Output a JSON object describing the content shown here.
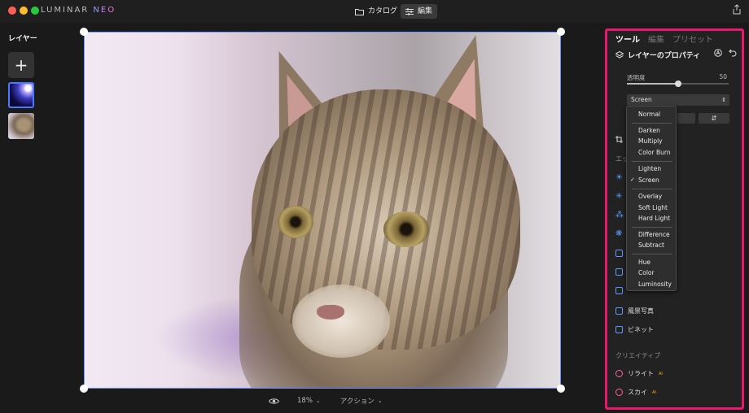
{
  "app": {
    "logo_main": "LUMINAR ",
    "logo_neo": "NEO"
  },
  "colors": {
    "accent_highlight": "#e6196f",
    "selection_border": "#4b78ff"
  },
  "topbar": {
    "catalog_label": "カタログ",
    "edit_label": "編集",
    "active": "edit"
  },
  "layers": {
    "title": "レイヤー",
    "add_symbol": "+"
  },
  "bottom": {
    "zoom": "18%",
    "action_label": "アクション"
  },
  "panel": {
    "tabs": [
      {
        "label": "ツール"
      },
      {
        "label": "編集"
      },
      {
        "label": "プリセット"
      }
    ],
    "properties_title": "レイヤーのプロパティ",
    "opacity_label": "透明度",
    "opacity_value": "50",
    "opacity_fraction": 0.5,
    "blend_mode": "Screen",
    "section_essentials": "エッ",
    "tools": [
      {
        "label": "風景写真",
        "icon": "landscape-icon"
      },
      {
        "label": "ビネット",
        "icon": "vignette-icon"
      }
    ],
    "section_creative": "クリエイティブ",
    "creative_tools": [
      {
        "label": "リライト",
        "ai": "AI",
        "icon": "relight-icon"
      },
      {
        "label": "スカイ",
        "ai": "AI",
        "icon": "sky-icon"
      }
    ]
  },
  "blend_dropdown": {
    "selected": "Screen",
    "groups": [
      [
        "Normal"
      ],
      [
        "Darken",
        "Multiply",
        "Color Burn"
      ],
      [
        "Lighten",
        "Screen"
      ],
      [
        "Overlay",
        "Soft Light",
        "Hard Light"
      ],
      [
        "Difference",
        "Subtract"
      ],
      [
        "Hue",
        "Color",
        "Luminosity"
      ]
    ]
  }
}
